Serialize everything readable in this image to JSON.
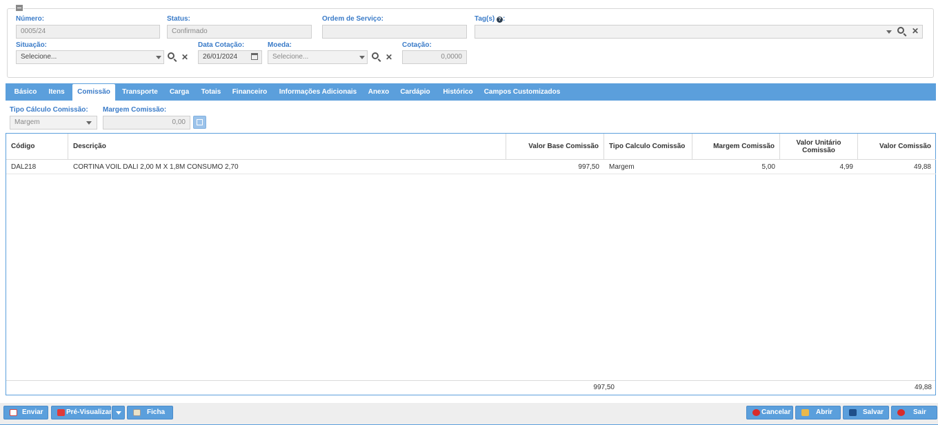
{
  "header": {
    "numero": {
      "label": "Número:",
      "value": "0005/24"
    },
    "status": {
      "label": "Status:",
      "value": "Confirmado"
    },
    "ordem_servico": {
      "label": "Ordem de Serviço:",
      "value": ""
    },
    "tags": {
      "label": "Tag(s)",
      "value": ""
    },
    "situacao": {
      "label": "Situação:",
      "value": "Selecione..."
    },
    "data_cotacao": {
      "label": "Data Cotação:",
      "value": "26/01/2024"
    },
    "moeda": {
      "label": "Moeda:",
      "value": "Selecione..."
    },
    "cotacao": {
      "label": "Cotação:",
      "value": "0,0000"
    }
  },
  "tabs": [
    {
      "label": "Básico"
    },
    {
      "label": "Itens"
    },
    {
      "label": "Comissão"
    },
    {
      "label": "Transporte"
    },
    {
      "label": "Carga"
    },
    {
      "label": "Totais"
    },
    {
      "label": "Financeiro"
    },
    {
      "label": "Informações Adicionais"
    },
    {
      "label": "Anexo"
    },
    {
      "label": "Cardápio"
    },
    {
      "label": "Histórico"
    },
    {
      "label": "Campos Customizados"
    }
  ],
  "commission": {
    "tipo_label": "Tipo Cálculo Comissão:",
    "tipo_value": "Margem",
    "margem_label": "Margem Comissão:",
    "margem_value": "0,00"
  },
  "grid": {
    "columns": [
      "Código",
      "Descrição",
      "Valor Base Comissão",
      "Tipo Calculo Comissão",
      "Margem Comissão",
      "Valor Unitário Comissão",
      "Valor Comissão"
    ],
    "rows": [
      [
        "DAL218",
        "CORTINA VOIL DALI 2,00 M X 1,8M CONSUMO 2,70",
        "997,50",
        "Margem",
        "5,00",
        "4,99",
        "49,88"
      ]
    ],
    "totals": {
      "valor_base": "997,50",
      "valor_comissao": "49,88"
    }
  },
  "buttons": {
    "enviar": "Enviar",
    "pre_visualizar": "Pré-Visualizar",
    "ficha": "Ficha",
    "cancelar": "Cancelar",
    "abrir": "Abrir",
    "salvar": "Salvar",
    "sair": "Sair"
  }
}
